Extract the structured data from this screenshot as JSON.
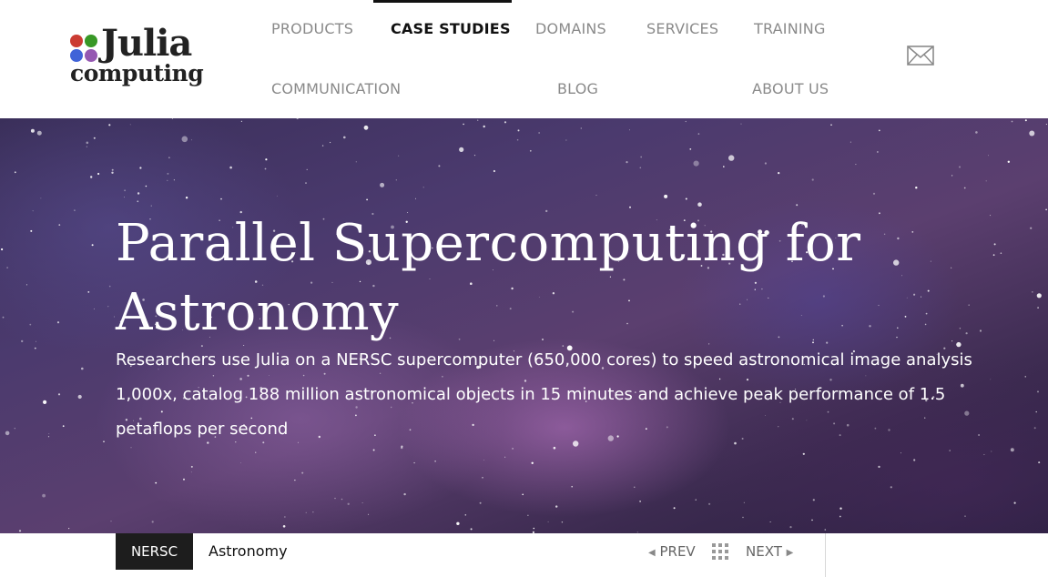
{
  "logo": {
    "word1": "Julia",
    "word2": "computing"
  },
  "nav": {
    "row1": [
      "PRODUCTS",
      "CASE STUDIES",
      "DOMAINS",
      "SERVICES",
      "TRAINING"
    ],
    "row2": [
      "COMMUNICATION",
      "BLOG",
      "ABOUT US"
    ],
    "active": "CASE STUDIES",
    "mail_icon": "envelope-icon"
  },
  "hero": {
    "title": "Parallel Supercomputing for Astronomy",
    "description": "Researchers use Julia on a NERSC supercomputer (650,000 cores) to speed astronomical image analysis 1,000x, catalog 188 million astronomical objects in 15 minutes and achieve peak performance of 1.5 petaflops per second"
  },
  "bottom": {
    "tag1": "NERSC",
    "tag2": "Astronomy",
    "prev": "PREV",
    "next": "NEXT",
    "grid_icon": "grid-icon"
  },
  "colors": {
    "active_text": "#111111",
    "nav_text": "#8a8a8a",
    "tag_bg": "#1d1d1d",
    "julia_red": "#cb3c33",
    "julia_green": "#389826",
    "julia_blue": "#4063d8",
    "julia_purple": "#9558b2"
  }
}
